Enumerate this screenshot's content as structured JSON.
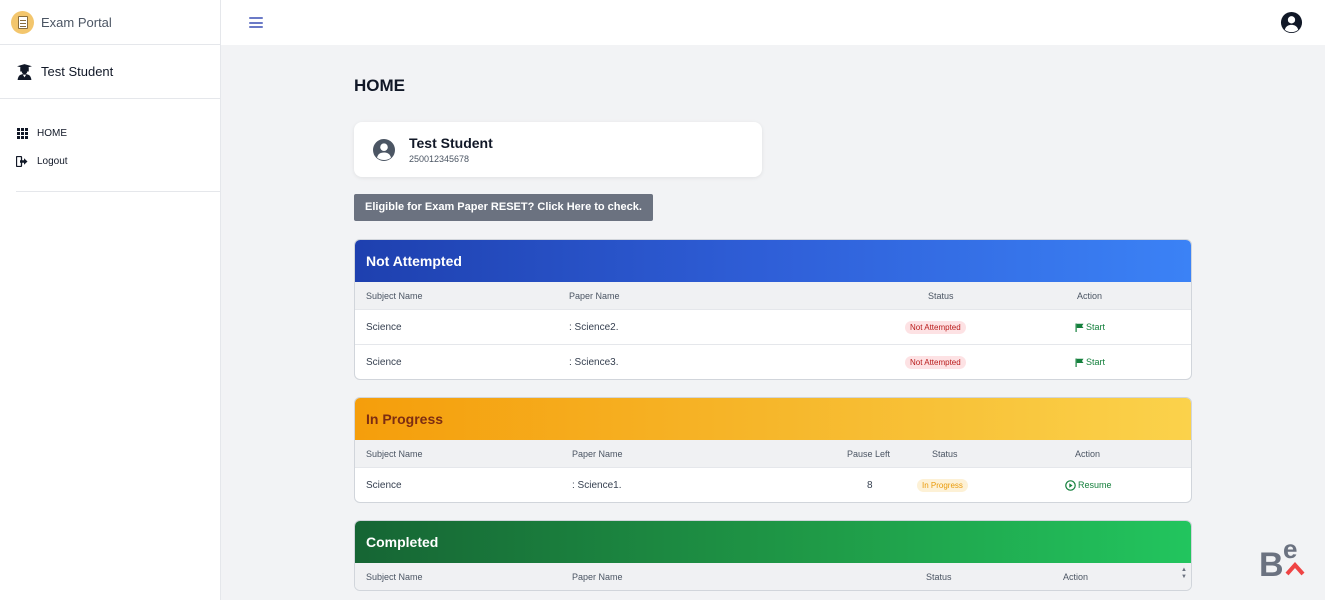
{
  "app": {
    "title": "Exam Portal"
  },
  "sidebar": {
    "user_name": "Test Student",
    "items": [
      {
        "label": "HOME",
        "icon": "grid-icon"
      },
      {
        "label": "Logout",
        "icon": "logout-icon"
      }
    ]
  },
  "topbar": {
    "menu_icon": "hamburger-icon",
    "account_icon": "account-icon"
  },
  "main": {
    "page_title": "HOME",
    "profile": {
      "name": "Test Student",
      "id": "250012345678"
    },
    "reset_button": "Eligible for Exam Paper RESET? Click Here to check."
  },
  "sections": {
    "not_attempted": {
      "title": "Not Attempted",
      "headers": {
        "subject": "Subject Name",
        "paper": "Paper Name",
        "status": "Status",
        "action": "Action"
      },
      "rows": [
        {
          "subject": "Science",
          "paper": ": Science2.",
          "status": "Not Attempted",
          "action": "Start"
        },
        {
          "subject": "Science",
          "paper": ": Science3.",
          "status": "Not Attempted",
          "action": "Start"
        }
      ]
    },
    "in_progress": {
      "title": "In Progress",
      "headers": {
        "subject": "Subject Name",
        "paper": "Paper Name",
        "pause_left": "Pause Left",
        "status": "Status",
        "action": "Action"
      },
      "rows": [
        {
          "subject": "Science",
          "paper": ": Science1.",
          "pause_left": "8",
          "status": "In Progress",
          "action": "Resume"
        }
      ]
    },
    "completed": {
      "title": "Completed",
      "headers": {
        "subject": "Subject Name",
        "paper": "Paper Name",
        "status": "Status",
        "action": "Action"
      }
    }
  },
  "colors": {
    "not_attempted_header": "#1e40af",
    "in_progress_header": "#f59e0b",
    "completed_header": "#166534",
    "action_green": "#15803d",
    "badge_red": "#b91c1c"
  }
}
